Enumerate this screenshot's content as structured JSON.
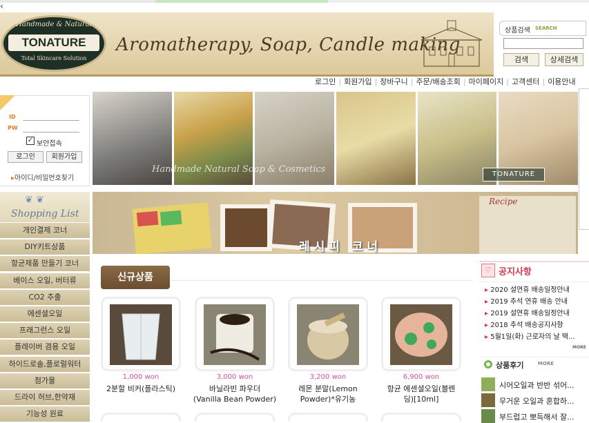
{
  "header": {
    "logo_top": "Handmade & Natural",
    "logo_name": "TONATURE",
    "logo_bottom": "Total Skincare Solution",
    "tagline": "Aromatherapy, Soap, Candle making"
  },
  "search": {
    "label": "상품검색",
    "sublabel": "SEARCH",
    "button": "검색",
    "adv_button": "상세검색"
  },
  "topnav": [
    "로그인",
    "회원가입",
    "장바구니",
    "주문/배송조회",
    "마이페이지",
    "고객센터",
    "이용안내"
  ],
  "login": {
    "id_label": "ID",
    "pw_label": "PW",
    "secure_label": "보안접속",
    "login_button": "로그인",
    "join_button": "회원가입",
    "find_link": "아이디/비밀번호찾기"
  },
  "hero": {
    "caption": "Handmade Natural Soap & Cosmetics",
    "brand": "TONATURE"
  },
  "recipe_banner": {
    "title": "레시피 코너",
    "note": "Recipe"
  },
  "sidebar": {
    "heading": "Shopping List",
    "categories": [
      "개인결제 코너",
      "DIY키트상품",
      "항균제품 만들기 코너",
      "베이스 오일, 버터류",
      "CO2 추출",
      "에센셜오일",
      "프래그런스 오일",
      "플레이버 겸용 오일",
      "하이드로솔,플로럴워터",
      "첨가물",
      "드라이 허브,한약재",
      "기능성 원료"
    ]
  },
  "new_products": {
    "heading": "신규상품",
    "items": [
      {
        "price": "1,000 won",
        "name_line1": "2분할 비커(플라스틱)",
        "name_line2": ""
      },
      {
        "price": "3,000 won",
        "name_line1": "바닐라빈 파우더",
        "name_line2": "(Vanilla Bean Powder)"
      },
      {
        "price": "3,200 won",
        "name_line1": "레몬 분말(Lemon",
        "name_line2": "Powder)*유기농"
      },
      {
        "price": "6,900 won",
        "name_line1": "항균 에센셜오일(블렌",
        "name_line2": "딩)[10ml]"
      }
    ]
  },
  "notice": {
    "heading": "공지사항",
    "items": [
      "2020 설연휴 배송일정안내",
      "2019 추석 연휴 배송 안내",
      "2019 설연휴 배송일정안내",
      "2018 추석 배송공지사항",
      "5월1일(화) 근로자의 날 택..."
    ],
    "more": "MORE"
  },
  "reviews": {
    "heading": "상품후기",
    "more": "MORE",
    "items": [
      "시어오일과 반반 섞어...",
      "무거운 오일과 혼합하...",
      "부드럽고 뽀득해서 잘..."
    ]
  }
}
